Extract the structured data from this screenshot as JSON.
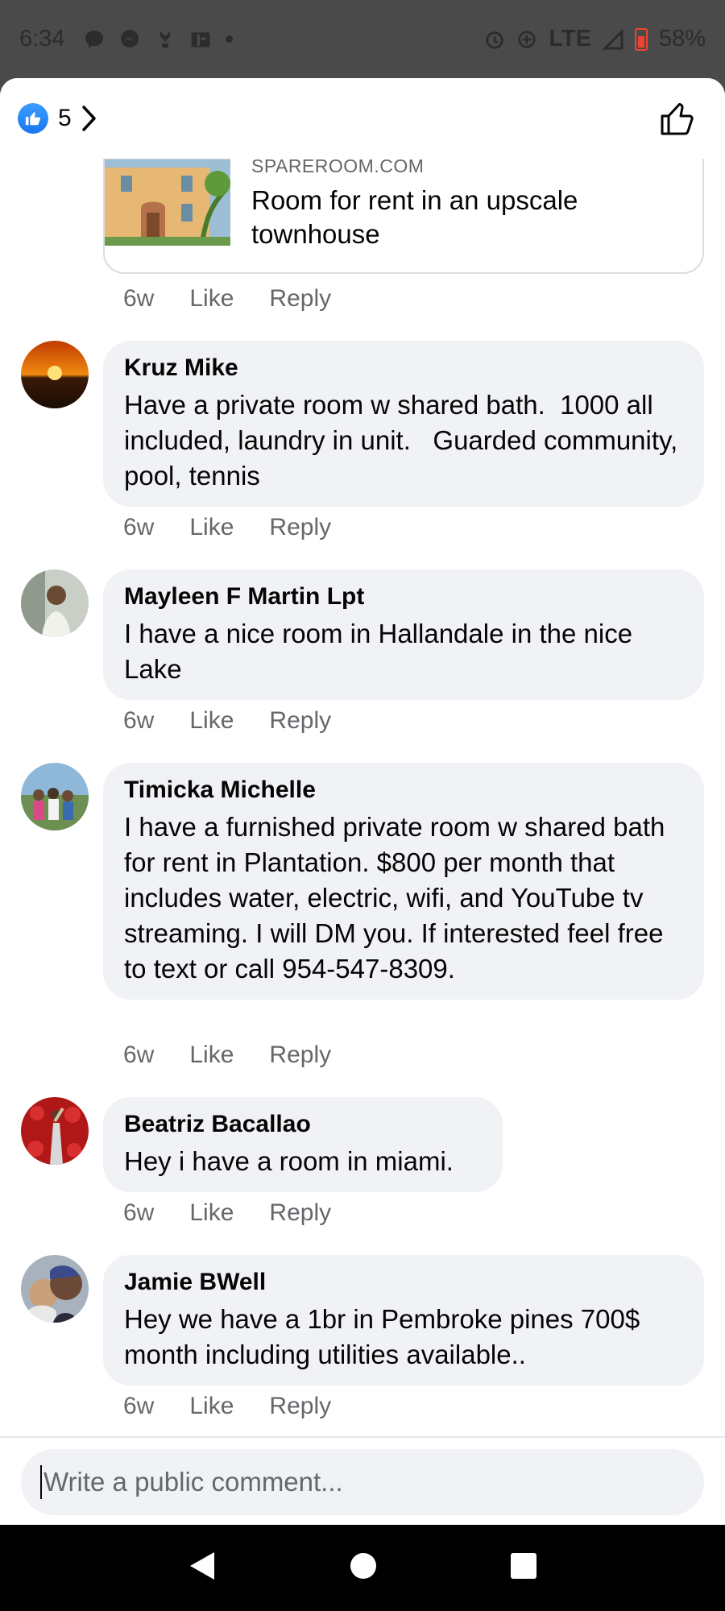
{
  "status_bar": {
    "time": "6:34",
    "network": "LTE",
    "battery": "58%",
    "icons": [
      "chat-icon",
      "messenger-icon",
      "notification-icon",
      "gallery-icon",
      "dot-icon",
      "alarm-icon",
      "data-saver-icon",
      "signal-icon",
      "battery-icon"
    ]
  },
  "header": {
    "reaction_count": "5",
    "reaction_icon": "thumbs-up-icon",
    "like_icon": "thumbs-up-outline-icon"
  },
  "link_preview": {
    "domain": "SPAREROOM.COM",
    "title": "Room for rent in an upscale townhouse"
  },
  "meta_labels": {
    "time": "6w",
    "like": "Like",
    "reply": "Reply"
  },
  "comments": [
    {
      "author": "Kruz Mike",
      "text": "Have a private room w shared bath.  1000 all included, laundry in unit.   Guarded community, pool, tennis",
      "time": "6w"
    },
    {
      "author": "Mayleen F Martin Lpt",
      "text": "I have a nice room in Hallandale in the nice Lake",
      "time": "6w"
    },
    {
      "author": "Timicka Michelle",
      "text": "I have a furnished private room w shared bath for rent in Plantation. $800 per month that  includes water, electric, wifi, and YouTube tv streaming. I will DM you. If interested feel free to text or call 954-547-8309.",
      "time": "6w"
    },
    {
      "author": "Beatriz Bacallao",
      "text": "Hey i have a room in miami.",
      "time": "6w"
    },
    {
      "author": "Jamie BWell",
      "text": "Hey we have a 1br in Pembroke pines 700$ month including utilities available..",
      "time": "6w"
    }
  ],
  "composer": {
    "placeholder": "Write a public comment..."
  },
  "colors": {
    "accent": "#1877f2",
    "bubble": "#f0f2f5",
    "secondary_text": "#65676b"
  }
}
